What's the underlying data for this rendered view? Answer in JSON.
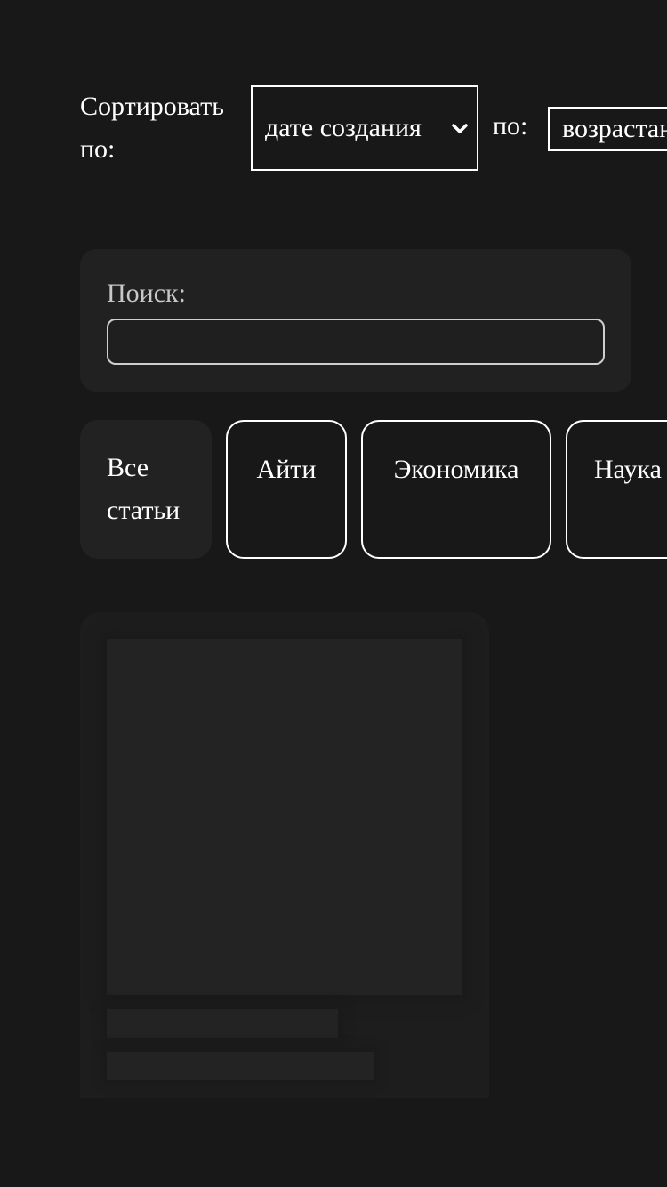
{
  "sort": {
    "label": "Сортировать по:",
    "field_value": "дате создания",
    "order_label": "по:",
    "order_value": "возрастанию"
  },
  "search": {
    "label": "Поиск:",
    "value": ""
  },
  "categories": [
    {
      "label": "Все статьи",
      "active": true
    },
    {
      "label": "Айти",
      "active": false
    },
    {
      "label": "Экономика",
      "active": false
    },
    {
      "label": "Наука",
      "active": false
    }
  ],
  "colors": {
    "background": "#181818",
    "panel": "#212121",
    "border": "#ffffff",
    "text": "#ffffff",
    "muted_text": "#c8c8c8"
  },
  "icons": {
    "sort_select_arrow": "chevron-down-icon"
  }
}
